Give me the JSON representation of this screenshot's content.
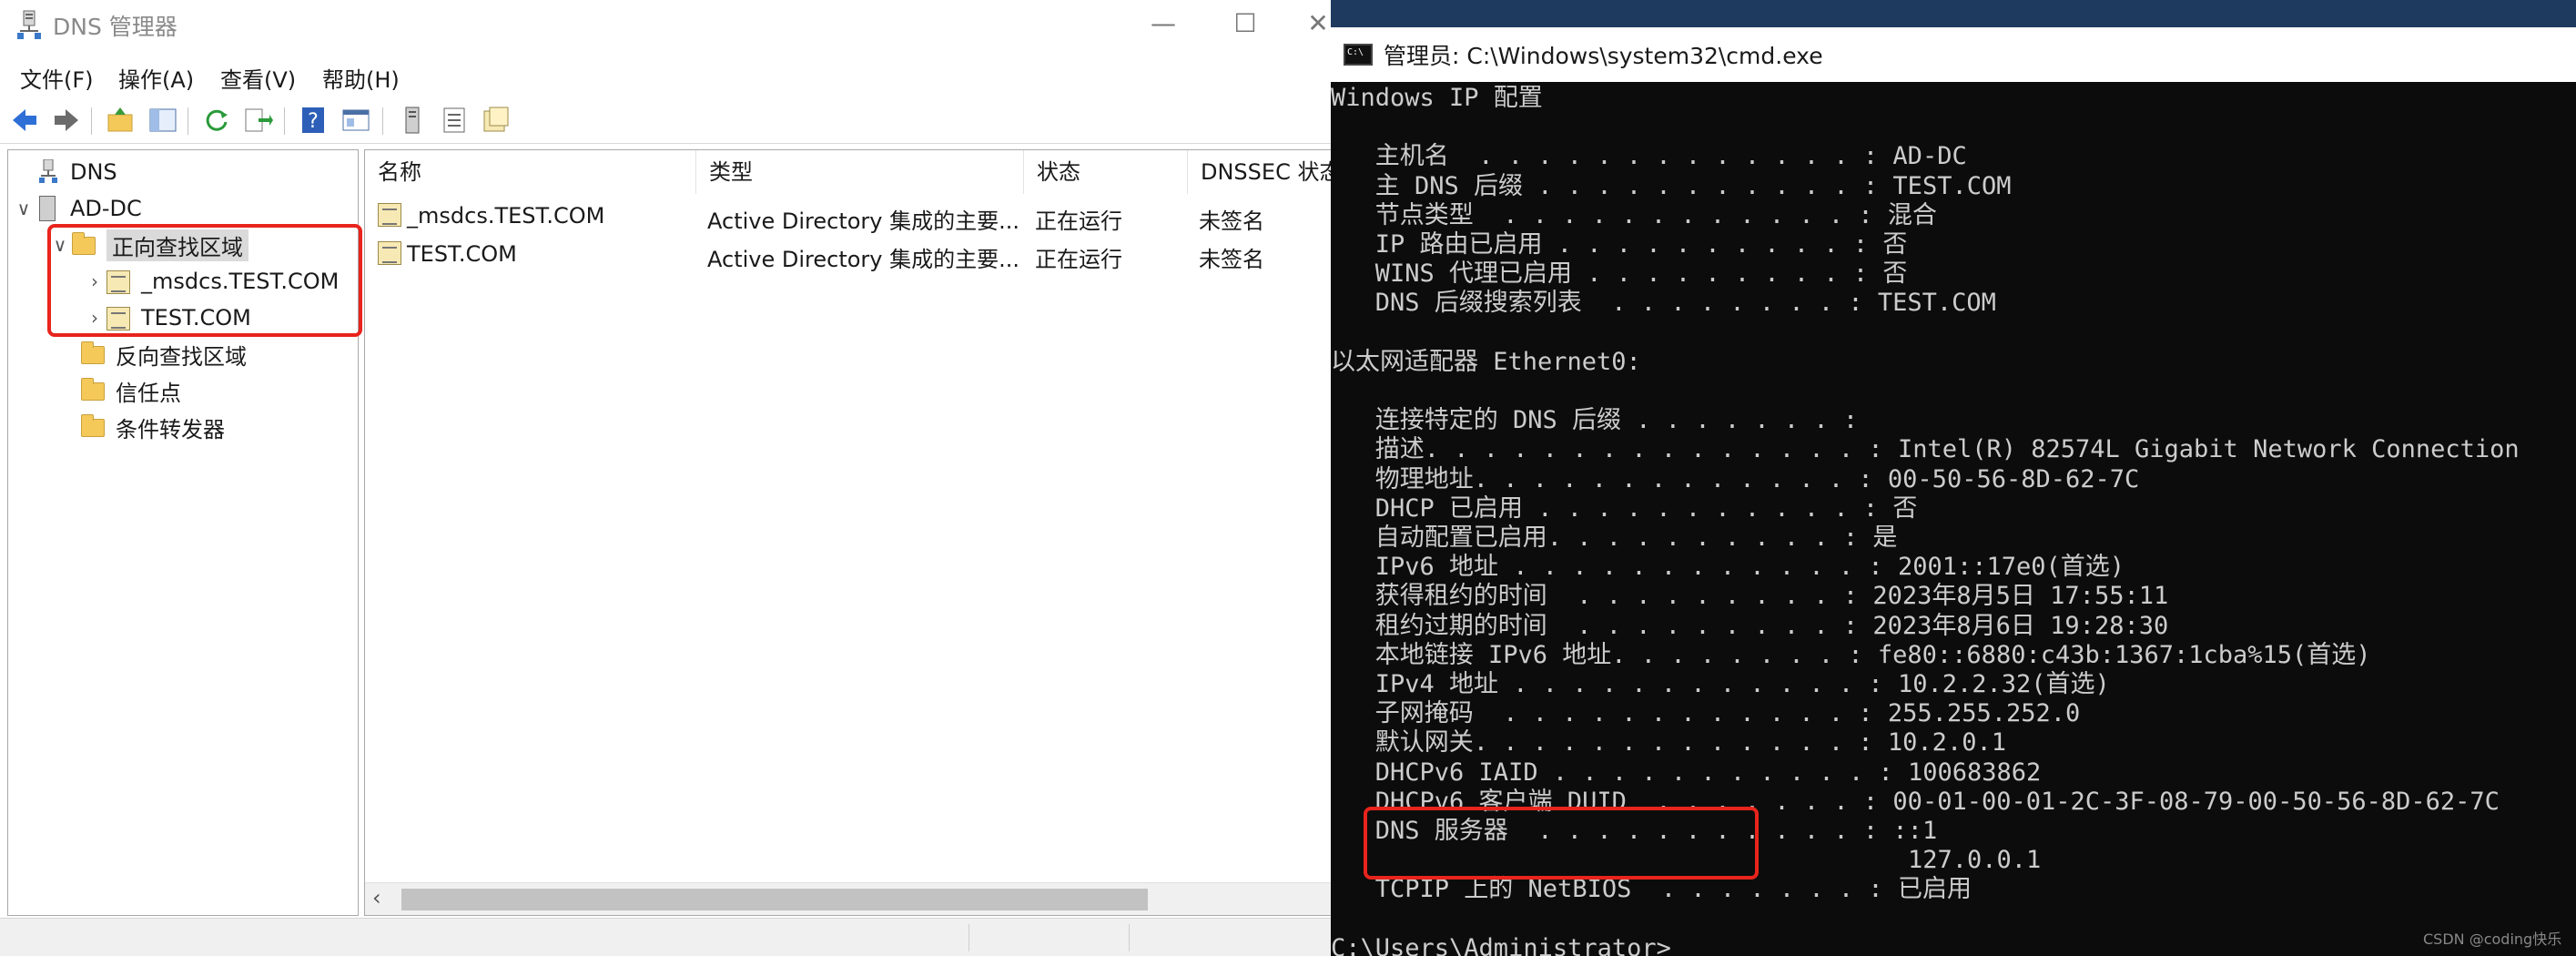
{
  "dns": {
    "title": "DNS 管理器",
    "window_buttons": {
      "minimize": "—",
      "maximize": "☐",
      "close": "✕"
    },
    "menu": [
      "文件(F)",
      "操作(A)",
      "查看(V)",
      "帮助(H)"
    ],
    "tree": [
      {
        "label": "DNS",
        "level": 0,
        "icon": "dns-icon",
        "expander": ""
      },
      {
        "label": "AD-DC",
        "level": 0,
        "icon": "server-icon",
        "expander": "∨"
      },
      {
        "label": "正向查找区域",
        "level": 1,
        "icon": "folder-icon",
        "expander": "∨",
        "selected": true
      },
      {
        "label": "_msdcs.TEST.COM",
        "level": 2,
        "icon": "zone-icon",
        "expander": "›"
      },
      {
        "label": "TEST.COM",
        "level": 2,
        "icon": "zone-icon",
        "expander": "›"
      },
      {
        "label": "反向查找区域",
        "level": 1,
        "icon": "folder-icon",
        "expander": ""
      },
      {
        "label": "信任点",
        "level": 1,
        "icon": "folder-icon",
        "expander": ""
      },
      {
        "label": "条件转发器",
        "level": 1,
        "icon": "folder-icon",
        "expander": ""
      }
    ],
    "columns": [
      "名称",
      "类型",
      "状态",
      "DNSSEC 状态"
    ],
    "rows": [
      {
        "name": "_msdcs.TEST.COM",
        "type": "Active Directory 集成的主要...",
        "status": "正在运行",
        "dnssec": "未签名"
      },
      {
        "name": "TEST.COM",
        "type": "Active Directory 集成的主要...",
        "status": "正在运行",
        "dnssec": "未签名"
      }
    ],
    "scroll_left": "‹"
  },
  "cmd": {
    "title": "管理员: C:\\Windows\\system32\\cmd.exe",
    "lines": [
      "Windows IP 配置",
      "",
      "   主机名  . . . . . . . . . . . . . : AD-DC",
      "   主 DNS 后缀 . . . . . . . . . . . : TEST.COM",
      "   节点类型  . . . . . . . . . . . . : 混合",
      "   IP 路由已启用 . . . . . . . . . . : 否",
      "   WINS 代理已启用 . . . . . . . . . : 否",
      "   DNS 后缀搜索列表  . . . . . . . . : TEST.COM",
      "",
      "以太网适配器 Ethernet0:",
      "",
      "   连接特定的 DNS 后缀 . . . . . . . :",
      "   描述. . . . . . . . . . . . . . . : Intel(R) 82574L Gigabit Network Connection",
      "   物理地址. . . . . . . . . . . . . : 00-50-56-8D-62-7C",
      "   DHCP 已启用 . . . . . . . . . . . : 否",
      "   自动配置已启用. . . . . . . . . . : 是",
      "   IPv6 地址 . . . . . . . . . . . . : 2001::17e0(首选)",
      "   获得租约的时间  . . . . . . . . . : 2023年8月5日 17:55:11",
      "   租约过期的时间  . . . . . . . . . : 2023年8月6日 19:28:30",
      "   本地链接 IPv6 地址. . . . . . . . : fe80::6880:c43b:1367:1cba%15(首选)",
      "   IPv4 地址 . . . . . . . . . . . . : 10.2.2.32(首选)",
      "   子网掩码  . . . . . . . . . . . . : 255.255.252.0",
      "   默认网关. . . . . . . . . . . . . : 10.2.0.1",
      "   DHCPv6 IAID . . . . . . . . . . . : 100683862",
      "   DHCPv6 客户端 DUID  . . . . . . . : 00-01-00-01-2C-3F-08-79-00-50-56-8D-62-7C",
      "   DNS 服务器  . . . . . . . . . . . : ::1",
      "                                       127.0.0.1",
      "   TCPIP 上的 NetBIOS  . . . . . . . : 已启用",
      "",
      "C:\\Users\\Administrator>"
    ]
  },
  "watermark": "CSDN @coding快乐"
}
